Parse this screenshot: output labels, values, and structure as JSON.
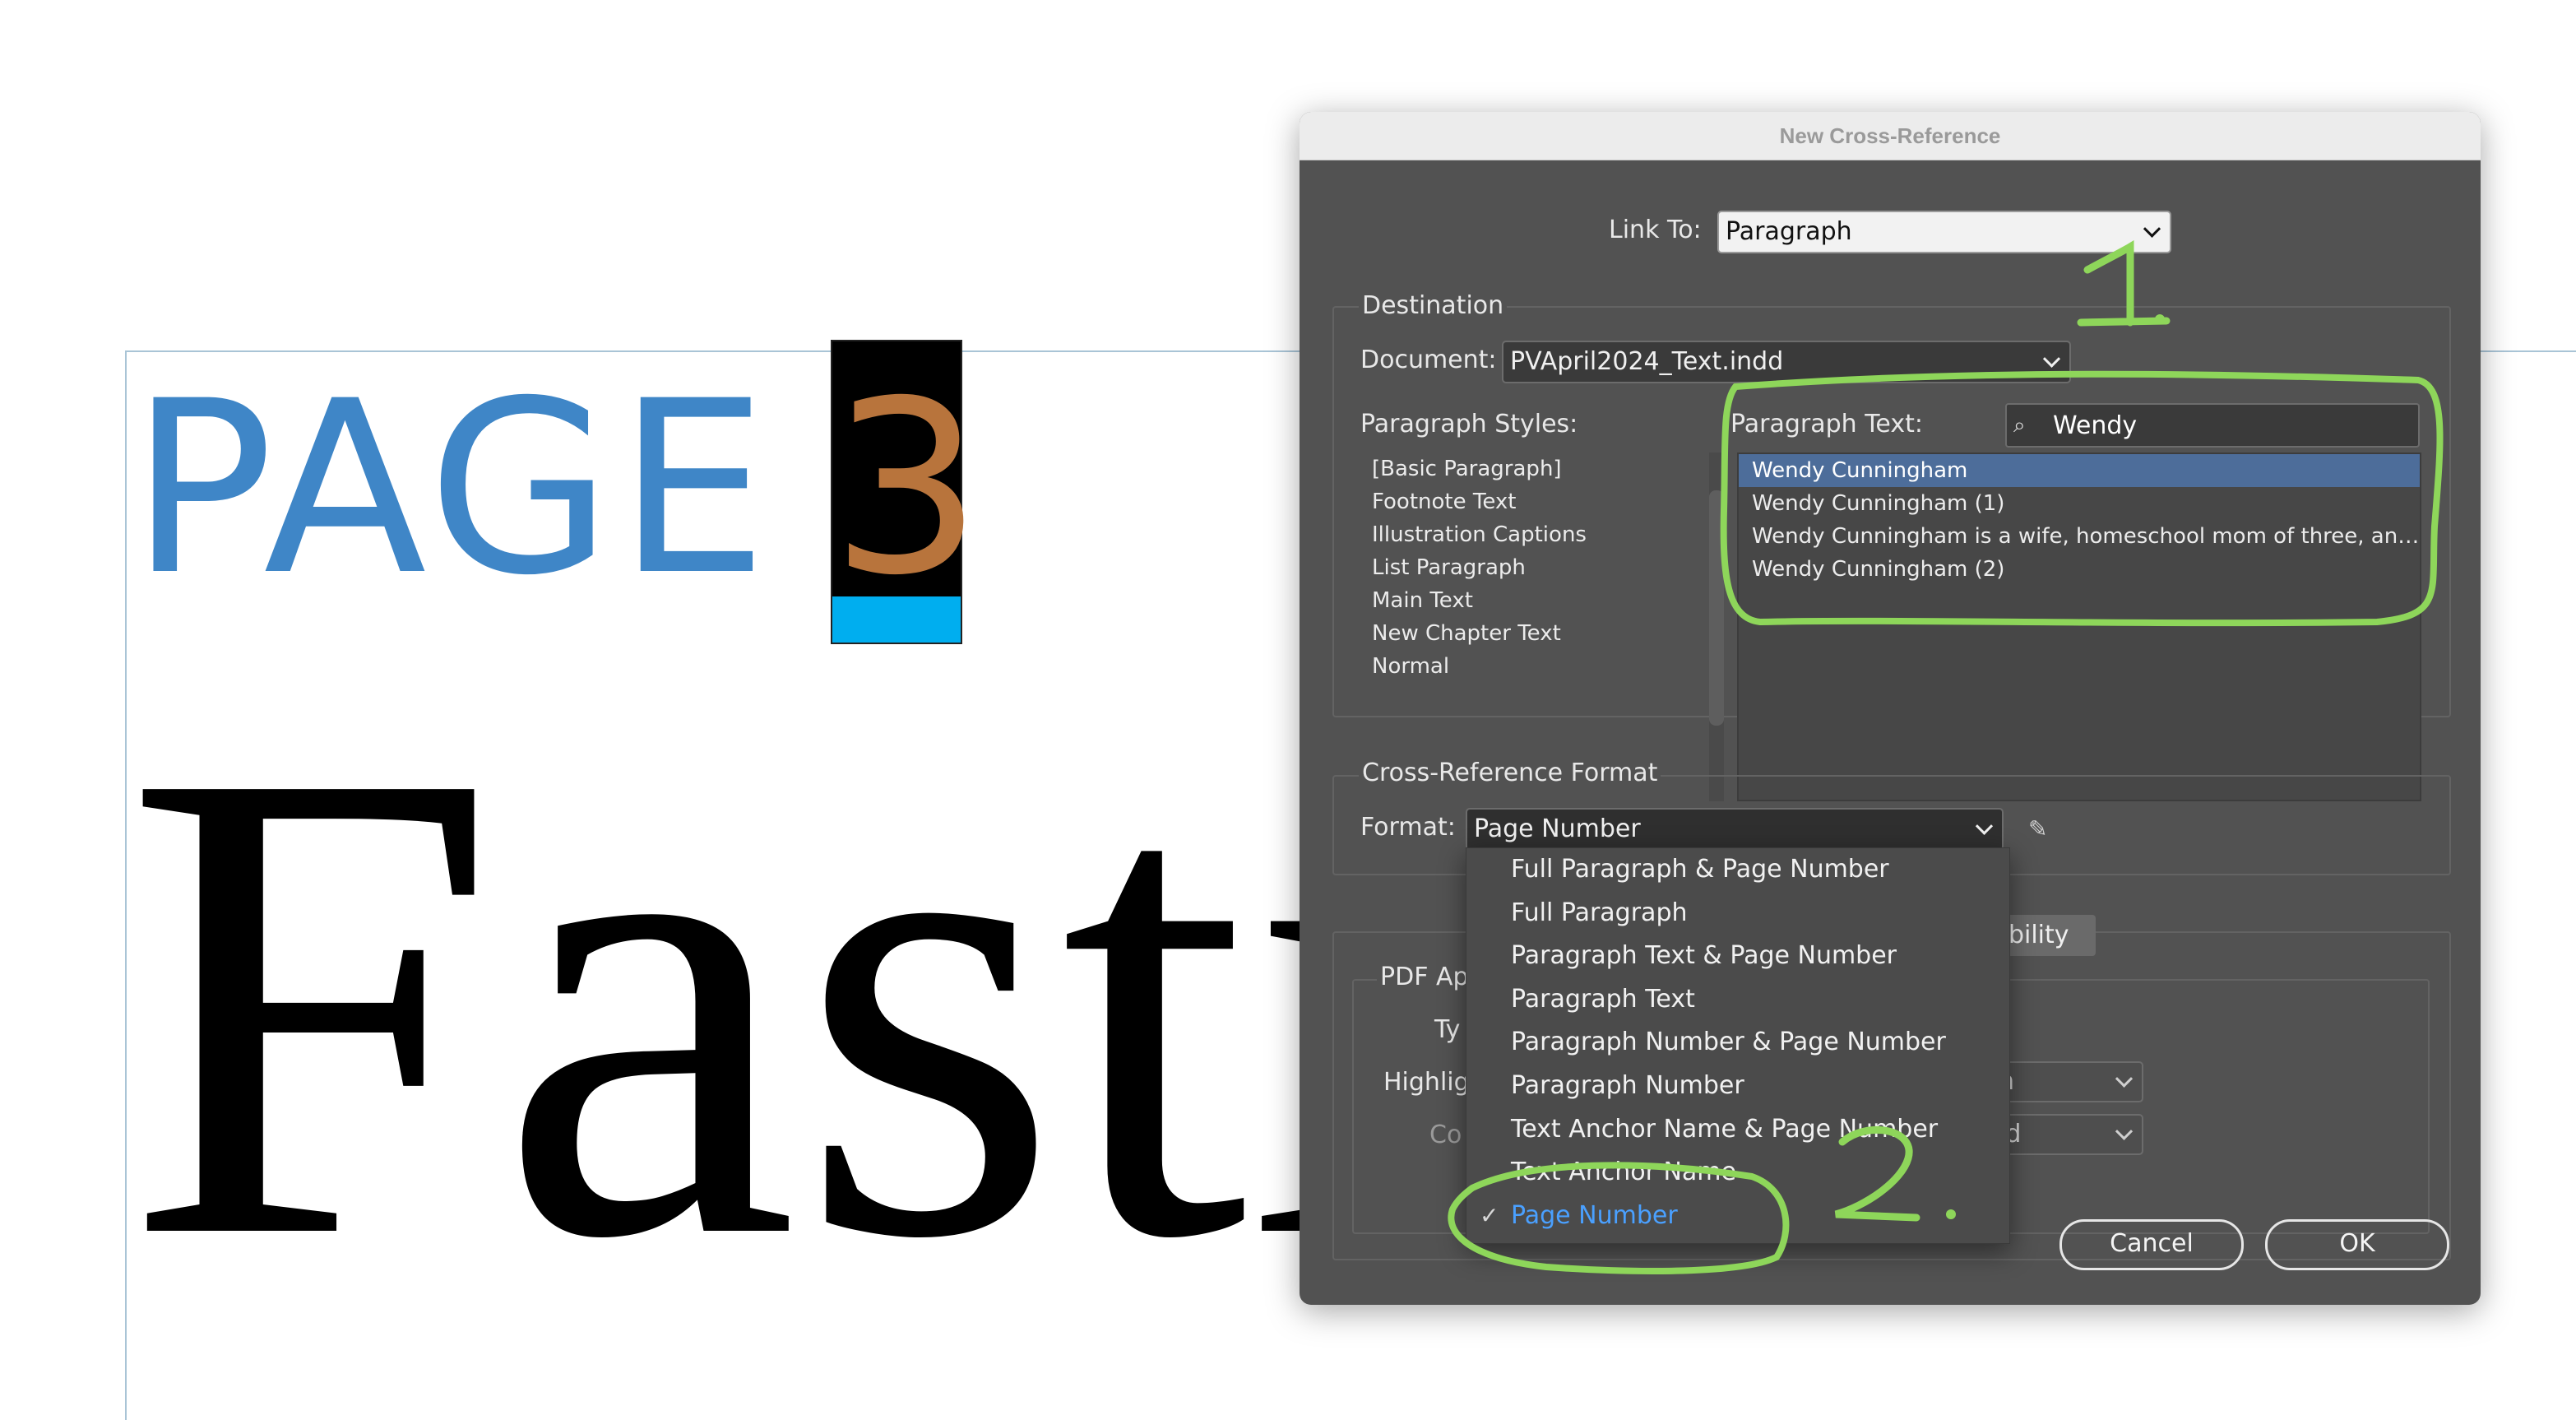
{
  "canvas": {
    "page_label": "PAGE",
    "page_number": "3",
    "heading_visible": "Fasti",
    "colors": {
      "page_label": "#3f86c7",
      "page_number": "#b8743c",
      "page_number_bar": "#00aeef",
      "frame": "#a9c4d6"
    }
  },
  "dialog": {
    "title": "New Cross-Reference",
    "link_to": {
      "label": "Link To:",
      "value": "Paragraph"
    },
    "destination": {
      "heading": "Destination",
      "document_label": "Document:",
      "document_value": "PVApril2024_Text.indd",
      "styles_label": "Paragraph Styles:",
      "styles": [
        "[Basic Paragraph]",
        "Footnote Text",
        "Illustration Captions",
        "List Paragraph",
        "Main Text",
        "New Chapter Text",
        "Normal"
      ],
      "text_label": "Paragraph Text:",
      "search_value": "Wendy",
      "texts": [
        "Wendy Cunningham",
        "Wendy Cunningham (1)",
        "Wendy Cunningham is a wife, homeschool mom of three, and a ...",
        "Wendy Cunningham (2)"
      ],
      "selected_text_index": 0
    },
    "format_section": {
      "heading": "Cross-Reference Format",
      "format_label": "Format:",
      "format_value": "Page Number"
    },
    "appearance": {
      "tab_fragment": "sibility",
      "group_fragment": "PDF Ap",
      "type_fragment": "Ty",
      "highlight_fragment": "Highlig",
      "color_fragment": "Co",
      "select1_fragment": "n",
      "select2_fragment": "id"
    },
    "format_menu": {
      "items": [
        "Full Paragraph & Page Number",
        "Full Paragraph",
        "Paragraph Text & Page Number",
        "Paragraph Text",
        "Paragraph Number & Page Number",
        "Paragraph Number",
        "Text Anchor Name & Page Number",
        "Text Anchor Name",
        "Page Number"
      ],
      "checked_index": 8,
      "check_glyph": "✓"
    },
    "buttons": {
      "cancel": "Cancel",
      "ok": "OK"
    }
  },
  "annotations": {
    "step1": "1.",
    "step2": "2.",
    "color": "#8ed65a"
  }
}
